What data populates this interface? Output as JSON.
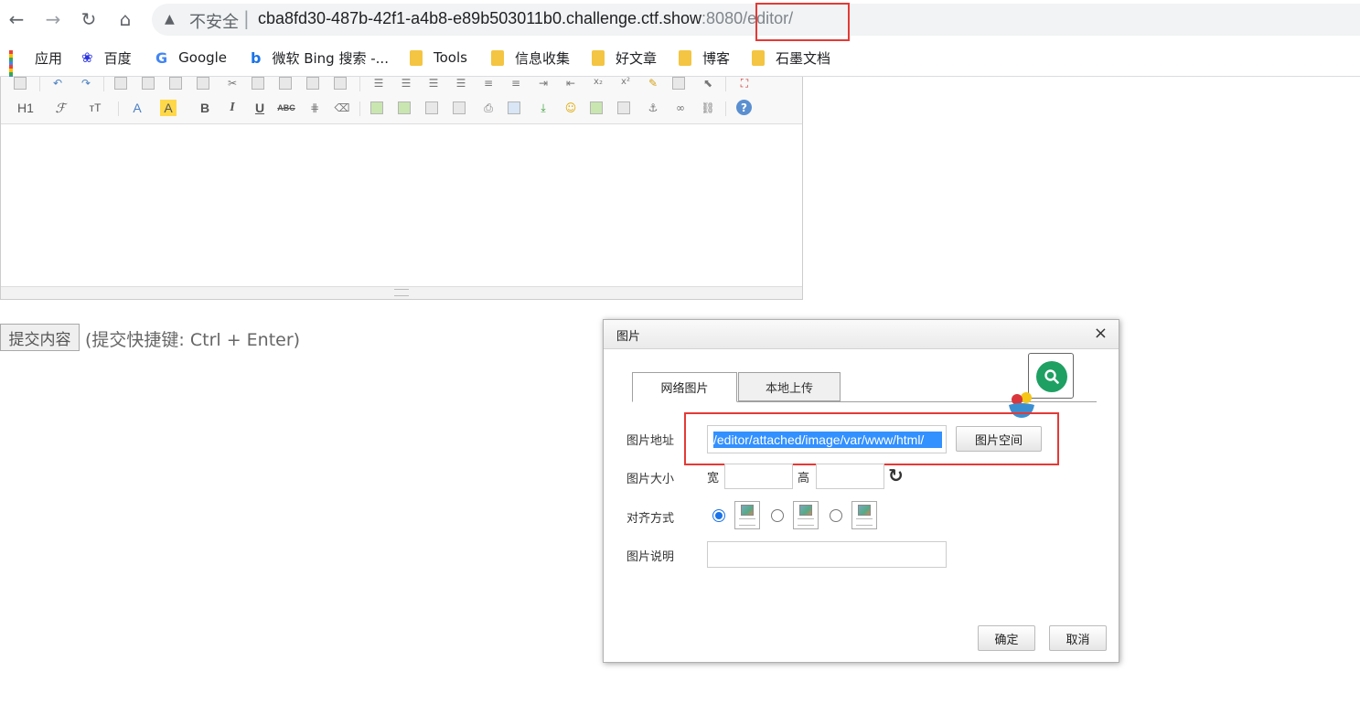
{
  "browser": {
    "nav": {
      "back": "←",
      "forward": "→",
      "reload": "↻",
      "home": "⌂"
    },
    "omnibox": {
      "warning_icon": "▲",
      "security_label": "不安全",
      "separator": "|",
      "url_host": "cba8fd30-487b-42f1-a4b8-e89b503011b0.challenge.ctf.show",
      "url_port": ":8080",
      "url_path": "/editor/"
    },
    "bookmarks": [
      {
        "label": "应用",
        "icon": "apps-grid-icon"
      },
      {
        "label": "百度",
        "icon": "baidu-paw-icon"
      },
      {
        "label": "Google",
        "icon": "google-icon"
      },
      {
        "label": "微软 Bing 搜索 -...",
        "icon": "bing-icon"
      },
      {
        "label": "Tools",
        "icon": "folder-icon"
      },
      {
        "label": "信息收集",
        "icon": "folder-icon"
      },
      {
        "label": "好文章",
        "icon": "folder-icon"
      },
      {
        "label": "博客",
        "icon": "folder-icon"
      },
      {
        "label": "石墨文档",
        "icon": "folder-icon"
      }
    ]
  },
  "editor": {
    "toolbar_row2_text": {
      "h1": "H1",
      "font": "ℱ",
      "size": "тT",
      "forecolor": "A",
      "hilite": "A",
      "bold": "B",
      "italic": "I",
      "underline": "U",
      "strike": "ABC",
      "sub": "x₂",
      "sup": "x²",
      "help": "?"
    }
  },
  "form": {
    "submit_label": "提交内容",
    "shortcut_hint": "(提交快捷键: Ctrl + Enter)"
  },
  "dialog": {
    "title": "图片",
    "close": "×",
    "tabs": [
      {
        "label": "网络图片",
        "active": true
      },
      {
        "label": "本地上传",
        "active": false
      }
    ],
    "url_label": "图片地址",
    "url_value": "/editor/attached/image/var/www/html/",
    "space_button": "图片空间",
    "size_label": "图片大小",
    "width_label": "宽",
    "height_label": "高",
    "refresh_icon": "↻",
    "align_label": "对齐方式",
    "align_selected": 0,
    "desc_label": "图片说明",
    "ok_button": "确定",
    "cancel_button": "取消",
    "search_icon": "magnifier-icon"
  }
}
